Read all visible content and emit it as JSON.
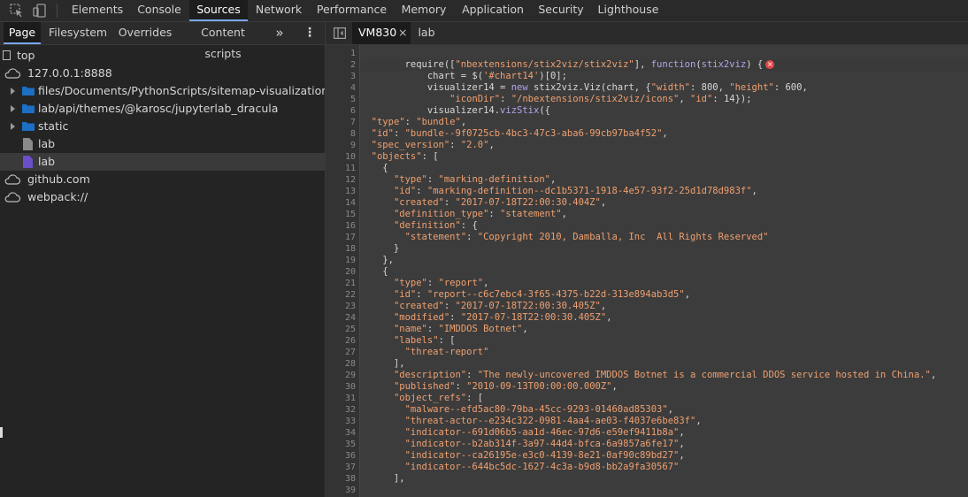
{
  "toolbar": {
    "tabs": [
      {
        "label": "Elements"
      },
      {
        "label": "Console"
      },
      {
        "label": "Sources",
        "active": true
      },
      {
        "label": "Network"
      },
      {
        "label": "Performance"
      },
      {
        "label": "Memory"
      },
      {
        "label": "Application"
      },
      {
        "label": "Security"
      },
      {
        "label": "Lighthouse"
      }
    ]
  },
  "navigator": {
    "tabs": [
      "Page",
      "Filesystem",
      "Overrides",
      "Content scripts"
    ],
    "more": "»",
    "menu": "⋮",
    "tree": [
      {
        "label": "top",
        "kind": "frame"
      },
      {
        "label": "127.0.0.1:8888",
        "kind": "origin",
        "expanded": true
      },
      {
        "label": "files/Documents/PythonScripts/sitemap-visualization/static",
        "kind": "folder"
      },
      {
        "label": "lab/api/themes/@karosc/jupyterlab_dracula",
        "kind": "folder"
      },
      {
        "label": "static",
        "kind": "folder"
      },
      {
        "label": "lab",
        "kind": "file"
      },
      {
        "label": "lab",
        "kind": "file",
        "selected": true
      },
      {
        "label": "github.com",
        "kind": "origin"
      },
      {
        "label": "webpack://",
        "kind": "origin"
      }
    ]
  },
  "editor": {
    "toggle_icon": "sidebar-toggle-icon",
    "tabs": [
      {
        "label": "VM830",
        "close": "×",
        "active": true
      },
      {
        "label": "lab"
      }
    ],
    "highlight_color": "#3a3a3a",
    "lines": [
      {
        "n": "1",
        "html": ""
      },
      {
        "n": "2",
        "html": "        require([<span class=\"s\">\"nbextensions/stix2viz/stix2viz\"</span>], <span class=\"k\">function</span>(<span class=\"k\">stix2viz</span>) {"
      },
      {
        "n": "3",
        "html": "            chart = $(<span class=\"s\">'#chart14'</span>)[0];"
      },
      {
        "n": "4",
        "html": "            visualizer14 = <span class=\"k\">new</span> stix2viz.Viz(chart, {<span class=\"s\">\"width\"</span>: 800, <span class=\"s\">\"height\"</span>: 600,"
      },
      {
        "n": "5",
        "html": "                <span class=\"s\">\"iconDir\"</span>: <span class=\"s\">\"/nbextensions/stix2viz/icons\"</span>, <span class=\"s\">\"id\"</span>: 14});"
      },
      {
        "n": "6",
        "html": "            visualizer14.<span class=\"k\">vizStix</span>({"
      },
      {
        "n": "7",
        "html": "  <span class=\"s\">\"type\"</span>: <span class=\"s\">\"bundle\"</span>,"
      },
      {
        "n": "8",
        "html": "  <span class=\"s\">\"id\"</span>: <span class=\"s\">\"bundle--9f0725cb-4bc3-47c3-aba6-99cb97ba4f52\"</span>,"
      },
      {
        "n": "9",
        "html": "  <span class=\"s\">\"spec_version\"</span>: <span class=\"s\">\"2.0\"</span>,"
      },
      {
        "n": "10",
        "html": "  <span class=\"s\">\"objects\"</span>: ["
      },
      {
        "n": "11",
        "html": "    {"
      },
      {
        "n": "12",
        "html": "      <span class=\"s\">\"type\"</span>: <span class=\"s\">\"marking-definition\"</span>,"
      },
      {
        "n": "13",
        "html": "      <span class=\"s\">\"id\"</span>: <span class=\"s\">\"marking-definition--dc1b5371-1918-4e57-93f2-25d1d78d983f\"</span>,"
      },
      {
        "n": "14",
        "html": "      <span class=\"s\">\"created\"</span>: <span class=\"s\">\"2017-07-18T22:00:30.404Z\"</span>,"
      },
      {
        "n": "15",
        "html": "      <span class=\"s\">\"definition_type\"</span>: <span class=\"s\">\"statement\"</span>,"
      },
      {
        "n": "16",
        "html": "      <span class=\"s\">\"definition\"</span>: {"
      },
      {
        "n": "17",
        "html": "        <span class=\"s\">\"statement\"</span>: <span class=\"s\">\"Copyright 2010, Damballa, Inc  All Rights Reserved\"</span>"
      },
      {
        "n": "18",
        "html": "      }"
      },
      {
        "n": "19",
        "html": "    },"
      },
      {
        "n": "20",
        "html": "    {"
      },
      {
        "n": "21",
        "html": "      <span class=\"s\">\"type\"</span>: <span class=\"s\">\"report\"</span>,"
      },
      {
        "n": "22",
        "html": "      <span class=\"s\">\"id\"</span>: <span class=\"s\">\"report--c6c7ebc4-3f65-4375-b22d-313e894ab3d5\"</span>,"
      },
      {
        "n": "23",
        "html": "      <span class=\"s\">\"created\"</span>: <span class=\"s\">\"2017-07-18T22:00:30.405Z\"</span>,"
      },
      {
        "n": "24",
        "html": "      <span class=\"s\">\"modified\"</span>: <span class=\"s\">\"2017-07-18T22:00:30.405Z\"</span>,"
      },
      {
        "n": "25",
        "html": "      <span class=\"s\">\"name\"</span>: <span class=\"s\">\"IMDDOS Botnet\"</span>,"
      },
      {
        "n": "26",
        "html": "      <span class=\"s\">\"labels\"</span>: ["
      },
      {
        "n": "27",
        "html": "        <span class=\"s\">\"threat-report\"</span>"
      },
      {
        "n": "28",
        "html": "      ],"
      },
      {
        "n": "29",
        "html": "      <span class=\"s\">\"description\"</span>: <span class=\"s\">\"The newly-uncovered IMDDOS Botnet is a commercial DDOS service hosted in China.\"</span>,"
      },
      {
        "n": "30",
        "html": "      <span class=\"s\">\"published\"</span>: <span class=\"s\">\"2010-09-13T00:00:00.000Z\"</span>,"
      },
      {
        "n": "31",
        "html": "      <span class=\"s\">\"object_refs\"</span>: ["
      },
      {
        "n": "32",
        "html": "        <span class=\"s\">\"malware--efd5ac80-79ba-45cc-9293-01460ad85303\"</span>,"
      },
      {
        "n": "33",
        "html": "        <span class=\"s\">\"threat-actor--e234c322-0981-4aa4-ae03-f4037e6be83f\"</span>,"
      },
      {
        "n": "34",
        "html": "        <span class=\"s\">\"indicator--691d06b5-aa1d-46ec-97d6-e59ef9411b8a\"</span>,"
      },
      {
        "n": "35",
        "html": "        <span class=\"s\">\"indicator--b2ab314f-3a97-44d4-bfca-6a9857a6fe17\"</span>,"
      },
      {
        "n": "36",
        "html": "        <span class=\"s\">\"indicator--ca26195e-e3c0-4139-8e21-0af90c89bd27\"</span>,"
      },
      {
        "n": "37",
        "html": "        <span class=\"s\">\"indicator--644bc5dc-1627-4c3a-b9d8-bb2a9fa30567\"</span>"
      },
      {
        "n": "38",
        "html": "      ],"
      },
      {
        "n": "39",
        "html": ""
      }
    ]
  }
}
